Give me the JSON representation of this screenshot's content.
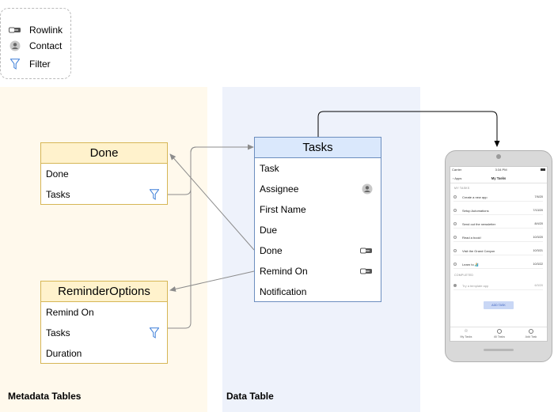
{
  "legend": {
    "items": [
      {
        "icon": "rowlink-icon",
        "label": "Rowlink"
      },
      {
        "icon": "contact-icon",
        "label": "Contact"
      },
      {
        "icon": "filter-icon",
        "label": "Filter"
      }
    ]
  },
  "bands": {
    "metadata_label": "Metadata Tables",
    "data_label": "Data Table"
  },
  "tables": {
    "done": {
      "title": "Done",
      "rows": [
        {
          "label": "Done"
        },
        {
          "label": "Tasks",
          "icon": "filter-icon"
        }
      ]
    },
    "reminder": {
      "title": "ReminderOptions",
      "rows": [
        {
          "label": "Remind On"
        },
        {
          "label": "Tasks",
          "icon": "filter-icon"
        },
        {
          "label": "Duration"
        }
      ]
    },
    "tasks": {
      "title": "Tasks",
      "rows": [
        {
          "label": "Task"
        },
        {
          "label": "Assignee",
          "icon": "contact-icon"
        },
        {
          "label": "First Name"
        },
        {
          "label": "Due"
        },
        {
          "label": "Done",
          "icon": "rowlink-icon"
        },
        {
          "label": "Remind On",
          "icon": "rowlink-icon"
        },
        {
          "label": "Notification"
        }
      ]
    }
  },
  "colors": {
    "yellow_header": "#fff2cc",
    "yellow_border": "#d6b656",
    "blue_header": "#dae8fc",
    "blue_border": "#6c8ebf",
    "filter_blue": "#3d7fd9",
    "meta_band": "#fff9ec",
    "data_band": "#eef2fb"
  },
  "phone": {
    "carrier": "Carrier",
    "time": "3:34 PM",
    "back_label": "Apps",
    "title": "My Tasks",
    "section_my_tasks": "MY TASKS",
    "tasks": [
      {
        "title": "Create a new app",
        "date": "7/6/20"
      },
      {
        "title": "Setup Automations",
        "date": "7/13/20"
      },
      {
        "title": "Send out the newsletter",
        "date": "8/4/20"
      },
      {
        "title": "Read a book!",
        "date": "10/3/20"
      },
      {
        "title": "Visit the Grand Canyon",
        "date": "10/3/21"
      },
      {
        "title": "Learn to 🏄",
        "date": "10/3/22"
      }
    ],
    "section_completed": "COMPLETED",
    "completed": [
      {
        "title": "Try a template app",
        "date": "6/3/20"
      }
    ],
    "add_button": "ADD TASK",
    "tabs": [
      "My Tasks",
      "All Tasks",
      "Add Task"
    ]
  }
}
